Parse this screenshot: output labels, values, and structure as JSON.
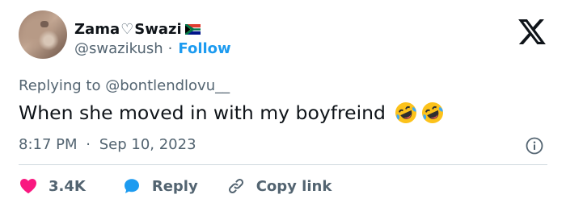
{
  "author": {
    "display_name": "Zama",
    "heart_symbol": "♡",
    "display_name_suffix": "Swazi",
    "flag_icon": "south-africa-flag-icon",
    "handle": "@swazikush",
    "separator": "·",
    "follow_label": "Follow"
  },
  "platform_logo": "x-logo-icon",
  "reply_context": {
    "prefix": "Replying to",
    "mention": "@bontlendlovu__"
  },
  "tweet": {
    "text": "When she moved in with my boyfreind",
    "emojis": [
      "rolling-on-floor-laughing-emoji",
      "rolling-on-floor-laughing-emoji"
    ]
  },
  "timestamp": {
    "time": "8:17 PM",
    "separator": "·",
    "date": "Sep 10, 2023"
  },
  "actions": {
    "like_count": "3.4K",
    "reply_label": "Reply",
    "copy_label": "Copy link"
  },
  "colors": {
    "accent": "#1d9bf0",
    "like": "#f91880",
    "secondary_text": "#536471",
    "divider": "#cfd9de"
  }
}
